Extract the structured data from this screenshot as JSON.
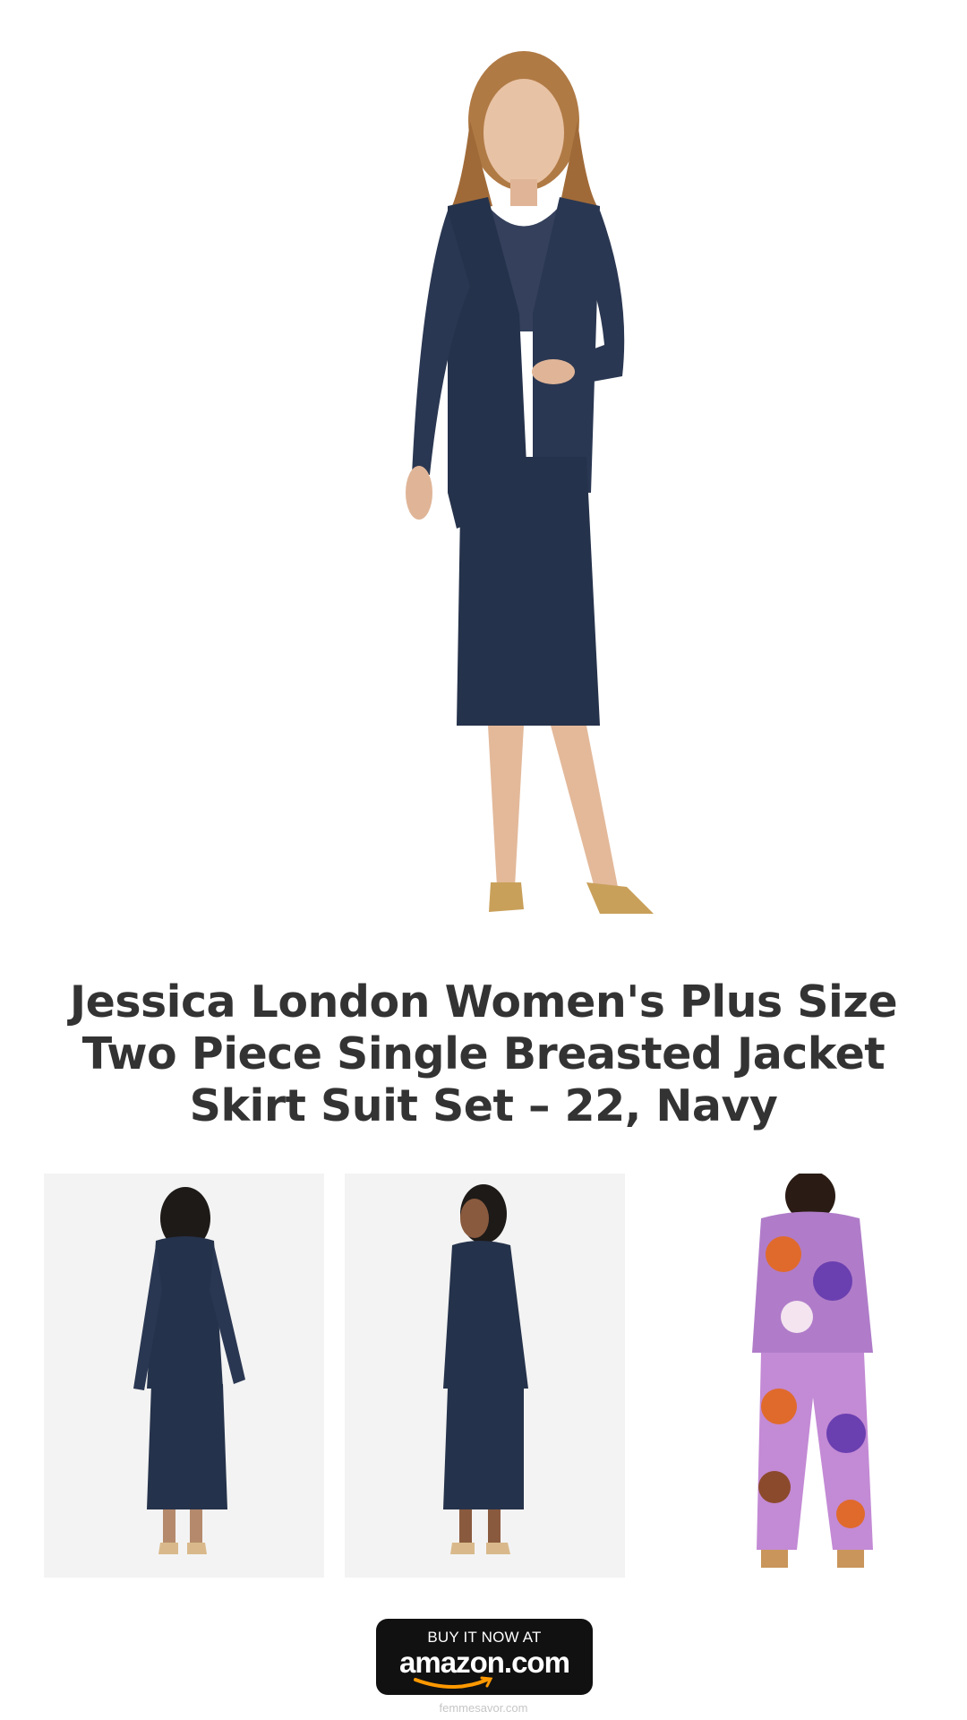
{
  "product": {
    "title": "Jessica London Women's Plus Size Two Piece Single Breasted Jacket Skirt Suit Set – 22, Navy"
  },
  "images": {
    "hero_icon": "model-navy-suit-front-image",
    "thumbnails": [
      {
        "icon": "model-navy-suit-back-image"
      },
      {
        "icon": "model-navy-suit-side-image"
      },
      {
        "icon": "model-floral-pant-set-image"
      }
    ]
  },
  "buy_button": {
    "line1": "BUY IT NOW AT",
    "line2": "amazon.com"
  },
  "footer": {
    "site": "femmesavor.com"
  },
  "colors": {
    "navy": "#25324b",
    "title_text": "#333333",
    "button_bg": "#111111",
    "amazon_orange": "#f90"
  }
}
